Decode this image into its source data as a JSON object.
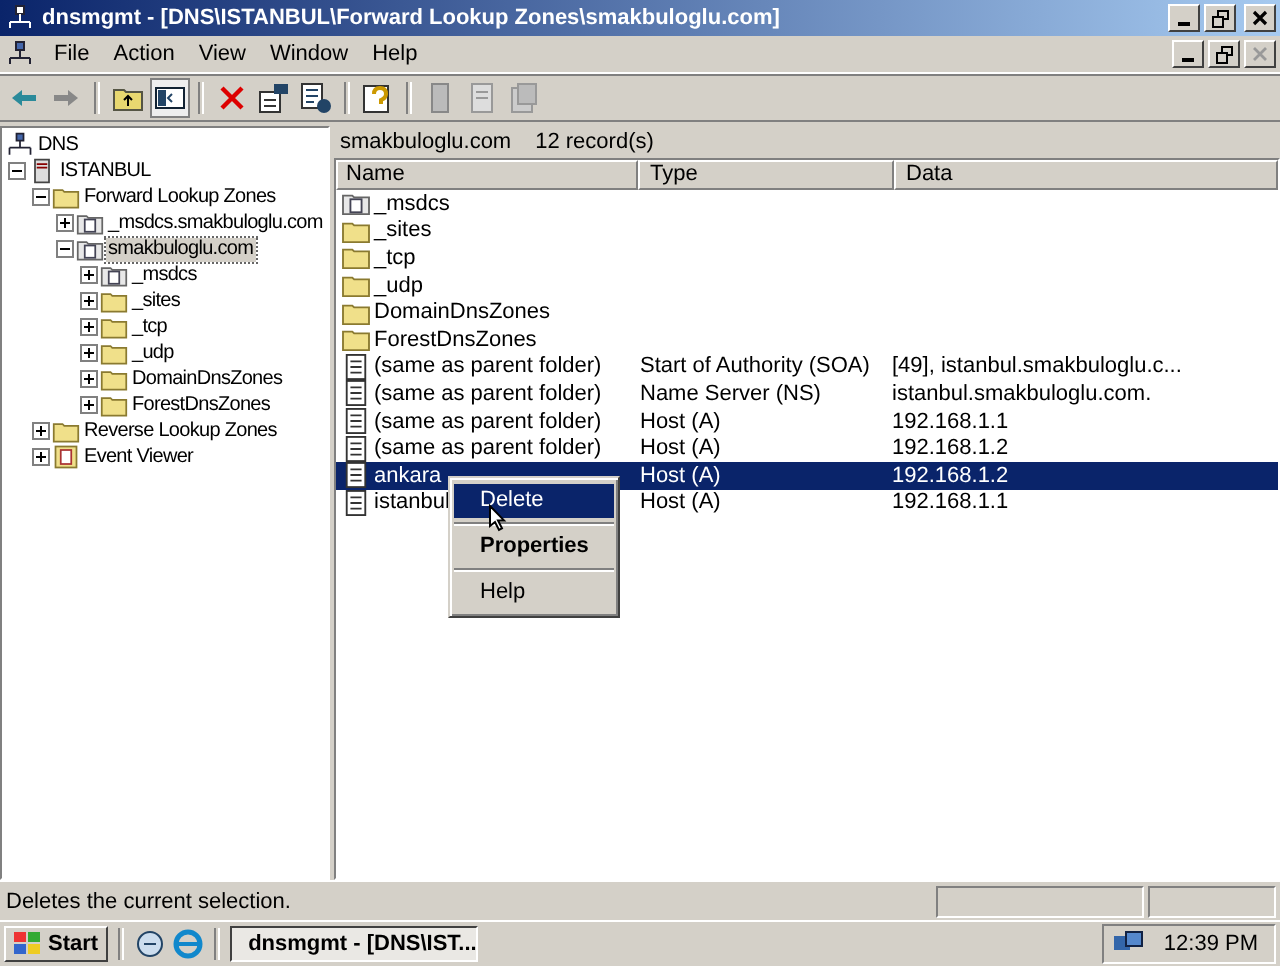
{
  "window": {
    "title": "dnsmgmt - [DNS\\ISTANBUL\\Forward Lookup Zones\\smakbuloglu.com]"
  },
  "menu": [
    "File",
    "Action",
    "View",
    "Window",
    "Help"
  ],
  "tree": [
    {
      "label": "DNS",
      "kind": "dns",
      "selected": false,
      "children": [
        {
          "label": "ISTANBUL",
          "kind": "server",
          "expanded": true,
          "selected": false,
          "children": [
            {
              "label": "Forward Lookup Zones",
              "kind": "folder",
              "expanded": true,
              "selected": false,
              "children": [
                {
                  "label": "_msdcs.smakbuloglu.com",
                  "kind": "zone",
                  "expanded": false,
                  "selected": false
                },
                {
                  "label": "smakbuloglu.com",
                  "kind": "zone",
                  "expanded": true,
                  "selected": true,
                  "children": [
                    {
                      "label": "_msdcs",
                      "kind": "zone",
                      "expanded": false,
                      "selected": false
                    },
                    {
                      "label": "_sites",
                      "kind": "folder",
                      "expanded": false,
                      "selected": false
                    },
                    {
                      "label": "_tcp",
                      "kind": "folder",
                      "expanded": false,
                      "selected": false
                    },
                    {
                      "label": "_udp",
                      "kind": "folder",
                      "expanded": false,
                      "selected": false
                    },
                    {
                      "label": "DomainDnsZones",
                      "kind": "folder",
                      "expanded": false,
                      "selected": false
                    },
                    {
                      "label": "ForestDnsZones",
                      "kind": "folder",
                      "expanded": false,
                      "selected": false
                    }
                  ]
                }
              ]
            },
            {
              "label": "Reverse Lookup Zones",
              "kind": "folder",
              "expanded": false,
              "selected": false
            },
            {
              "label": "Event Viewer",
              "kind": "event",
              "expanded": false,
              "selected": false
            }
          ]
        }
      ]
    }
  ],
  "list": {
    "zone": "smakbuloglu.com",
    "count": "12 record(s)",
    "columns": [
      "Name",
      "Type",
      "Data"
    ],
    "rows": [
      {
        "kind": "zone",
        "name": "_msdcs",
        "type": "",
        "data": "",
        "selected": false
      },
      {
        "kind": "folder",
        "name": "_sites",
        "type": "",
        "data": "",
        "selected": false
      },
      {
        "kind": "folder",
        "name": "_tcp",
        "type": "",
        "data": "",
        "selected": false
      },
      {
        "kind": "folder",
        "name": "_udp",
        "type": "",
        "data": "",
        "selected": false
      },
      {
        "kind": "folder",
        "name": "DomainDnsZones",
        "type": "",
        "data": "",
        "selected": false
      },
      {
        "kind": "folder",
        "name": "ForestDnsZones",
        "type": "",
        "data": "",
        "selected": false
      },
      {
        "kind": "record",
        "name": "(same as parent folder)",
        "type": "Start of Authority (SOA)",
        "data": "[49], istanbul.smakbuloglu.c...",
        "selected": false
      },
      {
        "kind": "record",
        "name": "(same as parent folder)",
        "type": "Name Server (NS)",
        "data": "istanbul.smakbuloglu.com.",
        "selected": false
      },
      {
        "kind": "record",
        "name": "(same as parent folder)",
        "type": "Host (A)",
        "data": "192.168.1.1",
        "selected": false
      },
      {
        "kind": "record",
        "name": "(same as parent folder)",
        "type": "Host (A)",
        "data": "192.168.1.2",
        "selected": false
      },
      {
        "kind": "record",
        "name": "ankara",
        "type": "Host (A)",
        "data": "192.168.1.2",
        "selected": true
      },
      {
        "kind": "record",
        "name": "istanbul",
        "type": "Host (A)",
        "data": "192.168.1.1",
        "selected": false
      }
    ]
  },
  "context_menu": [
    {
      "kind": "item",
      "label": "Delete",
      "selected": true,
      "default": false
    },
    {
      "kind": "separator"
    },
    {
      "kind": "item",
      "label": "Properties",
      "selected": false,
      "default": true
    },
    {
      "kind": "separator"
    },
    {
      "kind": "item",
      "label": "Help",
      "selected": false,
      "default": false
    }
  ],
  "status_bar": {
    "text": "Deletes the current selection."
  },
  "taskbar": {
    "start": "Start",
    "task": "dnsmgmt - [DNS\\IST...",
    "clock": "12:39 PM"
  }
}
